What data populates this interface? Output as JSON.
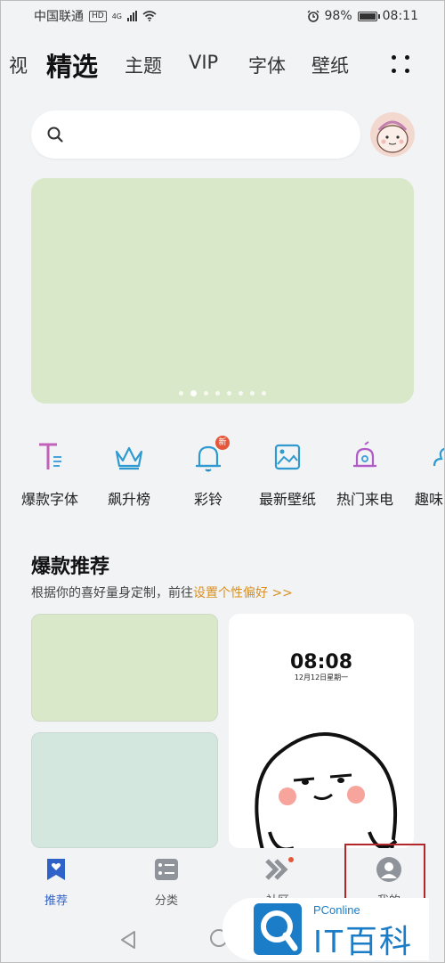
{
  "status_bar": {
    "carrier": "中国联通",
    "hd_badge": "HD",
    "network": "4G",
    "battery": "98%",
    "time": "08:11",
    "icons": [
      "signal-icon",
      "wifi-icon",
      "alarm-icon",
      "battery-icon"
    ]
  },
  "top_tabs": [
    {
      "label": "视"
    },
    {
      "label": "精选"
    },
    {
      "label": "主题"
    },
    {
      "label": "VIP"
    },
    {
      "label": "字体"
    },
    {
      "label": "壁纸"
    }
  ],
  "active_tab": "精选",
  "search": {
    "placeholder": ""
  },
  "banner": {
    "slide_count": 8,
    "active_slide": 2,
    "color": "#d8e8c8"
  },
  "shortcuts": [
    {
      "label": "爆款字体",
      "icon": "font-icon"
    },
    {
      "label": "飙升榜",
      "icon": "crown-icon"
    },
    {
      "label": "彩铃",
      "icon": "bell-icon",
      "badge": "新"
    },
    {
      "label": "最新壁纸",
      "icon": "wallpaper-icon"
    },
    {
      "label": "热门来电",
      "icon": "ringing-bell-icon"
    },
    {
      "label": "趣味",
      "icon": "partial-icon"
    }
  ],
  "recommend": {
    "title": "爆款推荐",
    "subtitle": "根据你的喜好量身定制，前往",
    "link": "设置个性偏好 >>",
    "preview_time": "08:08",
    "preview_date": "12月12日星期一"
  },
  "bottom_nav": [
    {
      "label": "推荐",
      "icon": "heart-bookmark-icon",
      "active": true
    },
    {
      "label": "分类",
      "icon": "category-icon",
      "active": false
    },
    {
      "label": "社区",
      "icon": "community-icon",
      "active": false
    },
    {
      "label": "我的",
      "icon": "profile-icon",
      "active": false
    }
  ],
  "watermark": {
    "small": "PConline",
    "big": "IT百科"
  },
  "colors": {
    "accent": "#2f62c9",
    "link": "#d9901e",
    "highlight_box": "#b3262a"
  }
}
